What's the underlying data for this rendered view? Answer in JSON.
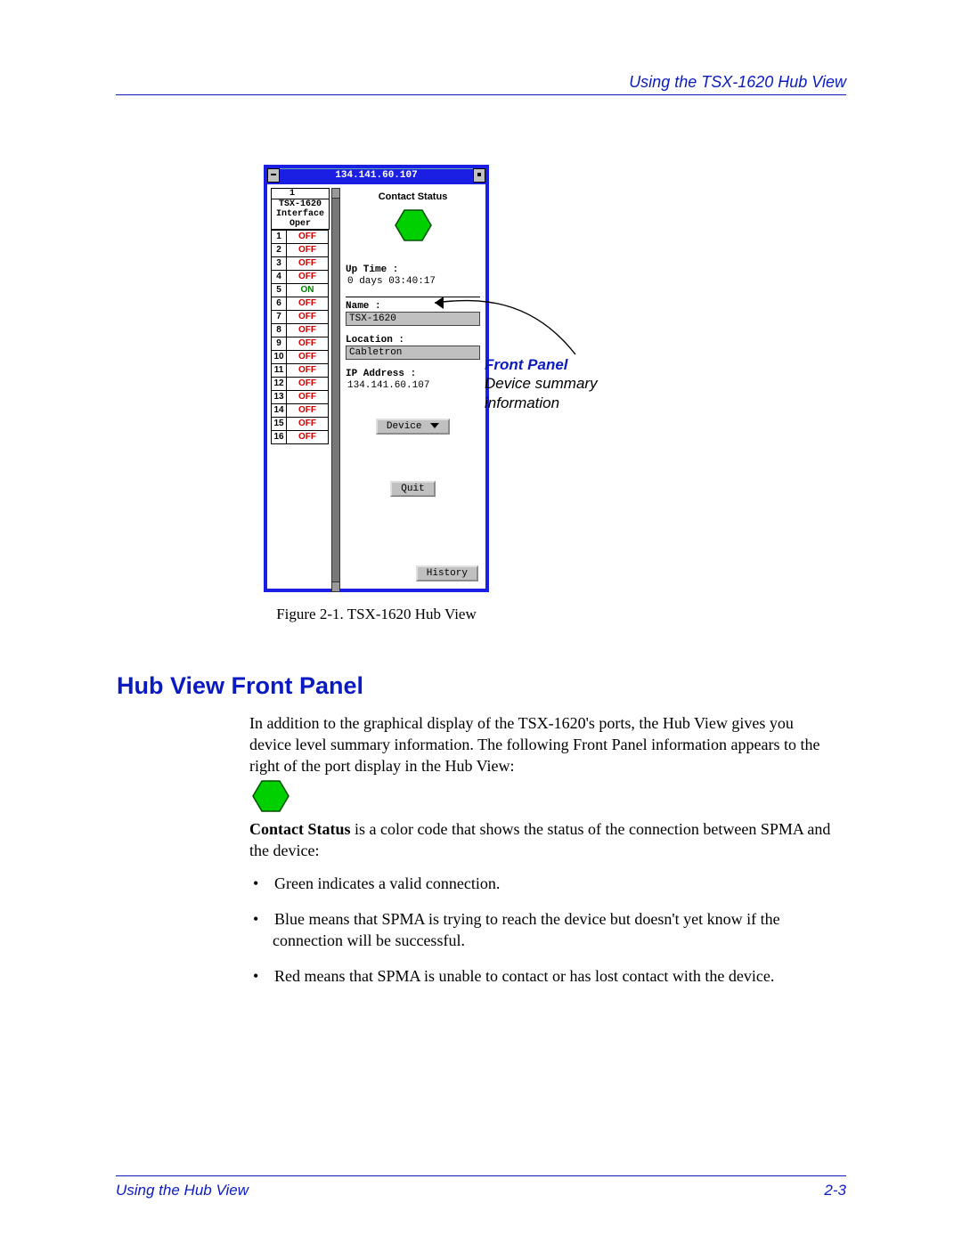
{
  "header": {
    "right": "Using the TSX-1620 Hub View"
  },
  "footer": {
    "left": "Using the Hub View",
    "right": "2-3"
  },
  "figure": {
    "titlebar_ip": "134.141.60.107",
    "module_col_num": "1",
    "module_name": "TSX-1620",
    "interface_label": "Interface",
    "oper_label": "Oper",
    "ports": [
      {
        "n": "1",
        "s": "OFF",
        "on": false
      },
      {
        "n": "2",
        "s": "OFF",
        "on": false
      },
      {
        "n": "3",
        "s": "OFF",
        "on": false
      },
      {
        "n": "4",
        "s": "OFF",
        "on": false
      },
      {
        "n": "5",
        "s": "ON",
        "on": true
      },
      {
        "n": "6",
        "s": "OFF",
        "on": false
      },
      {
        "n": "7",
        "s": "OFF",
        "on": false
      },
      {
        "n": "8",
        "s": "OFF",
        "on": false
      },
      {
        "n": "9",
        "s": "OFF",
        "on": false
      },
      {
        "n": "10",
        "s": "OFF",
        "on": false
      },
      {
        "n": "11",
        "s": "OFF",
        "on": false
      },
      {
        "n": "12",
        "s": "OFF",
        "on": false
      },
      {
        "n": "13",
        "s": "OFF",
        "on": false
      },
      {
        "n": "14",
        "s": "OFF",
        "on": false
      },
      {
        "n": "15",
        "s": "OFF",
        "on": false
      },
      {
        "n": "16",
        "s": "OFF",
        "on": false
      }
    ],
    "contact_status_label": "Contact Status",
    "uptime_label": "Up Time :",
    "uptime_value": "0 days 03:40:17",
    "name_label": "Name :",
    "name_value": "TSX-1620",
    "location_label": "Location :",
    "location_value": "Cabletron",
    "ip_label": "IP Address :",
    "ip_value": "134.141.60.107",
    "device_button": "Device",
    "quit_button": "Quit",
    "history_button": "History",
    "caption": "Figure 2-1.  TSX-1620 Hub View"
  },
  "annotation": {
    "title": "Front Panel",
    "line1": "Device summary",
    "line2": "information"
  },
  "section": {
    "heading": "Hub View Front Panel",
    "para1": "In addition to the graphical display of the TSX-1620's ports, the Hub View gives you device level summary information. The following Front Panel information appears to the right of the port display in the Hub View:",
    "para2a": "Contact Status",
    "para2b": " is a color code that shows the status of the connection between SPMA and the device:",
    "bullets": [
      "Green indicates a valid connection.",
      "Blue means that SPMA is trying to reach the device but doesn't yet know if the connection will be successful.",
      "Red means that SPMA is unable to contact or has lost contact with the device."
    ]
  }
}
